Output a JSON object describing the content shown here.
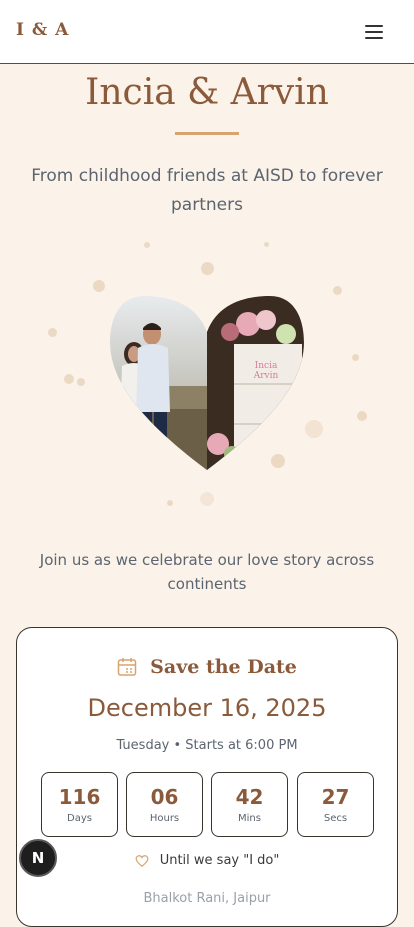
{
  "header": {
    "logo": "I & A",
    "menu_icon": "hamburger-menu-icon"
  },
  "hero": {
    "title": "Incia & Arvin",
    "tagline": "From childhood friends at AISD to forever partners",
    "photo_icon": "heart-photo-collage",
    "invite_line": "Join us as we celebrate our love story across continents"
  },
  "save_the_date": {
    "icon": "calendar-icon",
    "title": "Save the Date",
    "date": "December 16, 2025",
    "time": "Tuesday • Starts at 6:00 PM",
    "countdown": [
      {
        "value": "116",
        "label": "Days"
      },
      {
        "value": "06",
        "label": "Hours"
      },
      {
        "value": "42",
        "label": "Mins"
      },
      {
        "value": "27",
        "label": "Secs"
      }
    ],
    "until_text": "Until we say \"I do\"",
    "until_icon": "heart-outline-icon",
    "venue_cut": "Bhalkot Rani, Jaipur"
  },
  "dev_badge": {
    "label": "N"
  },
  "colors": {
    "accent": "#8a5a3b",
    "gold": "#d7a36e",
    "background": "#fbf3e9"
  }
}
